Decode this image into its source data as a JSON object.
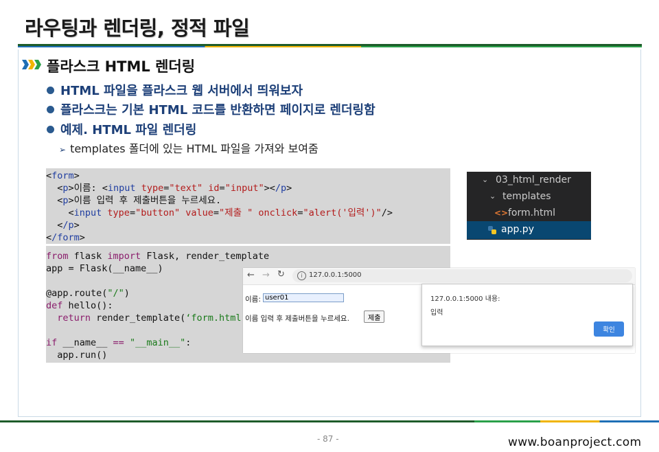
{
  "title": "라우팅과 렌더링, 정적 파일",
  "section_title": "플라스크 HTML 렌더링",
  "bullets": [
    "HTML 파일을 플라스크 웹 서버에서 띄워보자",
    "플라스크는 기본 HTML 코드를 반환하면 페이지로 렌더링함",
    "예제. HTML 파일 렌더링"
  ],
  "sub_bullet": "templates 폴더에 있는 HTML 파일을 가져와 보여줌",
  "html_code": {
    "form_open": "form",
    "p_tag": "p",
    "label_name": "이름: ",
    "input_tag": "input",
    "type_attr": "type",
    "type_text": "\"text\"",
    "id_attr": "id",
    "id_val": "\"input\"",
    "p_close": "/p",
    "instruction": "이름 입력 후 제출버튼을 누르세요.",
    "type_button": "\"button\"",
    "value_attr": "value",
    "value_val": "\"제출 \"",
    "onclick_attr": "onclick",
    "onclick_val": "\"alert('입력')\"",
    "form_close": "/form"
  },
  "py_code": {
    "kw_from": "from",
    "mod": " flask ",
    "kw_import": "import",
    "imports": " Flask, render_template",
    "app_line": "app = Flask(__name__)",
    "route_head": "@app.route(",
    "route_str": "\"/\"",
    "route_tail": ")",
    "kw_def": "def",
    "def_rest": " hello():",
    "kw_return": "return",
    "ret_head": " render_template(",
    "ret_str": "‘form.html ’",
    "ret_tail": " )",
    "kw_if": "if",
    "if_mid": " __name__ ",
    "op_eq": "==",
    "main_str": " \"__main__\"",
    "if_tail": ":",
    "run_line": "app.run()"
  },
  "file_tree": {
    "folder": "03_html_render",
    "templates": "templates",
    "form_file": "form.html",
    "app_file": "app.py"
  },
  "browser": {
    "url": "127.0.0.1:5000",
    "name_label": "이름:",
    "name_value": "user01",
    "instruction": "이름 입력 후 제출버튼을 누르세요.",
    "submit_label": "제출"
  },
  "alert": {
    "title": "127.0.0.1:5000 내용:",
    "message": "입력",
    "ok_label": "확인"
  },
  "page_number": "- 87 -",
  "footer_url": "www.boanproject.com",
  "colors": {
    "bullet_text": "#1c3f78",
    "alert_button": "#3d85e0",
    "tree_selected": "#094771"
  }
}
